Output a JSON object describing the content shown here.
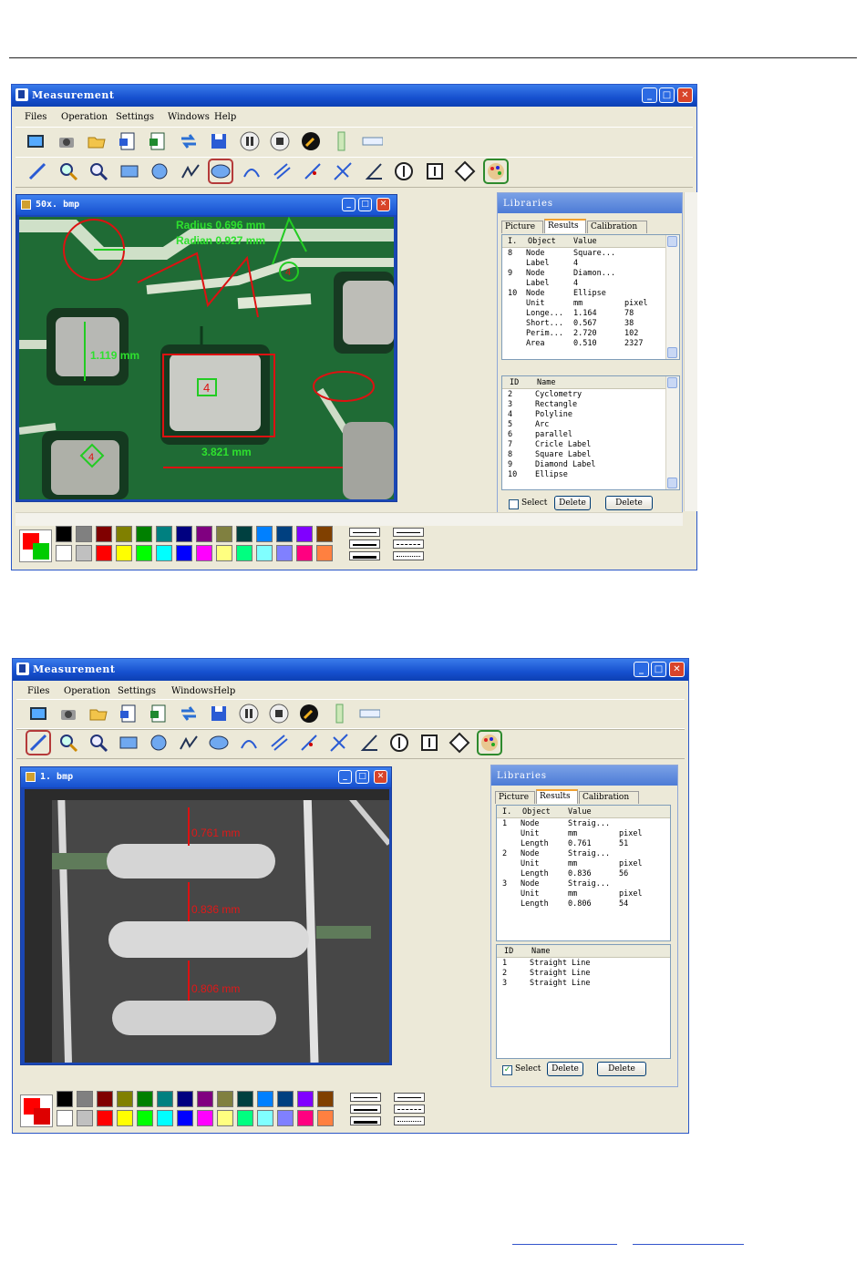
{
  "screens": [
    {
      "window_title": "Measurement",
      "menu": [
        "Files",
        "Operation",
        "Settings",
        "Windows",
        "Help"
      ],
      "doc_title": "50x. bmp",
      "overlays": {
        "radius": "Radius 0.696 mm",
        "radian": "Radian 0.927 mm",
        "label4_a": "4",
        "label4_b": "4",
        "label4_c": "4",
        "height": "1.119 mm",
        "width": "3.821 mm"
      },
      "panel_title": "Libraries",
      "tabs": [
        "Picture",
        "Results",
        "Calibration"
      ],
      "results_headers": [
        "I.",
        "Object",
        "Value"
      ],
      "results_rows": [
        [
          "8",
          "Node",
          "Square...",
          ""
        ],
        [
          "",
          "Label",
          "4",
          ""
        ],
        [
          "9",
          "Node",
          "Diamon...",
          ""
        ],
        [
          "",
          "Label",
          "4",
          ""
        ],
        [
          "10",
          "Node",
          "Ellipse",
          ""
        ],
        [
          "",
          "Unit",
          "mm",
          "pixel"
        ],
        [
          "",
          "Longe...",
          "1.164",
          "78"
        ],
        [
          "",
          "Short...",
          "0.567",
          "38"
        ],
        [
          "",
          "Perim...",
          "2.720",
          "102"
        ],
        [
          "",
          "Area",
          "0.510",
          "2327"
        ]
      ],
      "names_headers": [
        "ID",
        "Name"
      ],
      "names_rows": [
        [
          "2",
          "Cyclometry"
        ],
        [
          "3",
          "Rectangle"
        ],
        [
          "4",
          "Polyline"
        ],
        [
          "5",
          "Arc"
        ],
        [
          "6",
          "parallel"
        ],
        [
          "7",
          "Cricle Label"
        ],
        [
          "8",
          "Square Label"
        ],
        [
          "9",
          "Diamond Label"
        ],
        [
          "10",
          "Ellipse"
        ]
      ],
      "select_label": "Select",
      "delete_label": "Delete",
      "delete2_label": "Delete"
    },
    {
      "window_title": "Measurement",
      "menu": [
        "Files",
        "Operation",
        "Settings",
        "Windows",
        "Help"
      ],
      "doc_title": "1. bmp",
      "overlays": {
        "m1": "0.761 mm",
        "m2": "0.836 mm",
        "m3": "0.806 mm"
      },
      "panel_title": "Libraries",
      "tabs": [
        "Picture",
        "Results",
        "Calibration"
      ],
      "results_headers": [
        "I.",
        "Object",
        "Value"
      ],
      "results_rows": [
        [
          "1",
          "Node",
          "Straig...",
          ""
        ],
        [
          "",
          "Unit",
          "mm",
          "pixel"
        ],
        [
          "",
          "Length",
          "0.761",
          "51"
        ],
        [
          "2",
          "Node",
          "Straig...",
          ""
        ],
        [
          "",
          "Unit",
          "mm",
          "pixel"
        ],
        [
          "",
          "Length",
          "0.836",
          "56"
        ],
        [
          "3",
          "Node",
          "Straig...",
          ""
        ],
        [
          "",
          "Unit",
          "mm",
          "pixel"
        ],
        [
          "",
          "Length",
          "0.806",
          "54"
        ]
      ],
      "names_headers": [
        "ID",
        "Name"
      ],
      "names_rows": [
        [
          "1",
          "Straight Line"
        ],
        [
          "2",
          "Straight Line"
        ],
        [
          "3",
          "Straight Line"
        ]
      ],
      "select_label": "Select",
      "delete_label": "Delete",
      "delete2_label": "Delete"
    }
  ],
  "palette_top": [
    "#000000",
    "#808080",
    "#800000",
    "#808000",
    "#008000",
    "#008080",
    "#000080",
    "#800080",
    "#808040",
    "#004040",
    "#0080ff",
    "#004080",
    "#8000ff",
    "#804000"
  ],
  "palette_bottom": [
    "#ffffff",
    "#c0c0c0",
    "#ff0000",
    "#ffff00",
    "#00ff00",
    "#00ffff",
    "#0000ff",
    "#ff00ff",
    "#ffff80",
    "#00ff80",
    "#80ffff",
    "#8080ff",
    "#ff0080",
    "#ff8040"
  ],
  "primary_color": "#ff0000",
  "secondary_color_1": "#00cc00",
  "secondary_color_2": "#dd0000"
}
